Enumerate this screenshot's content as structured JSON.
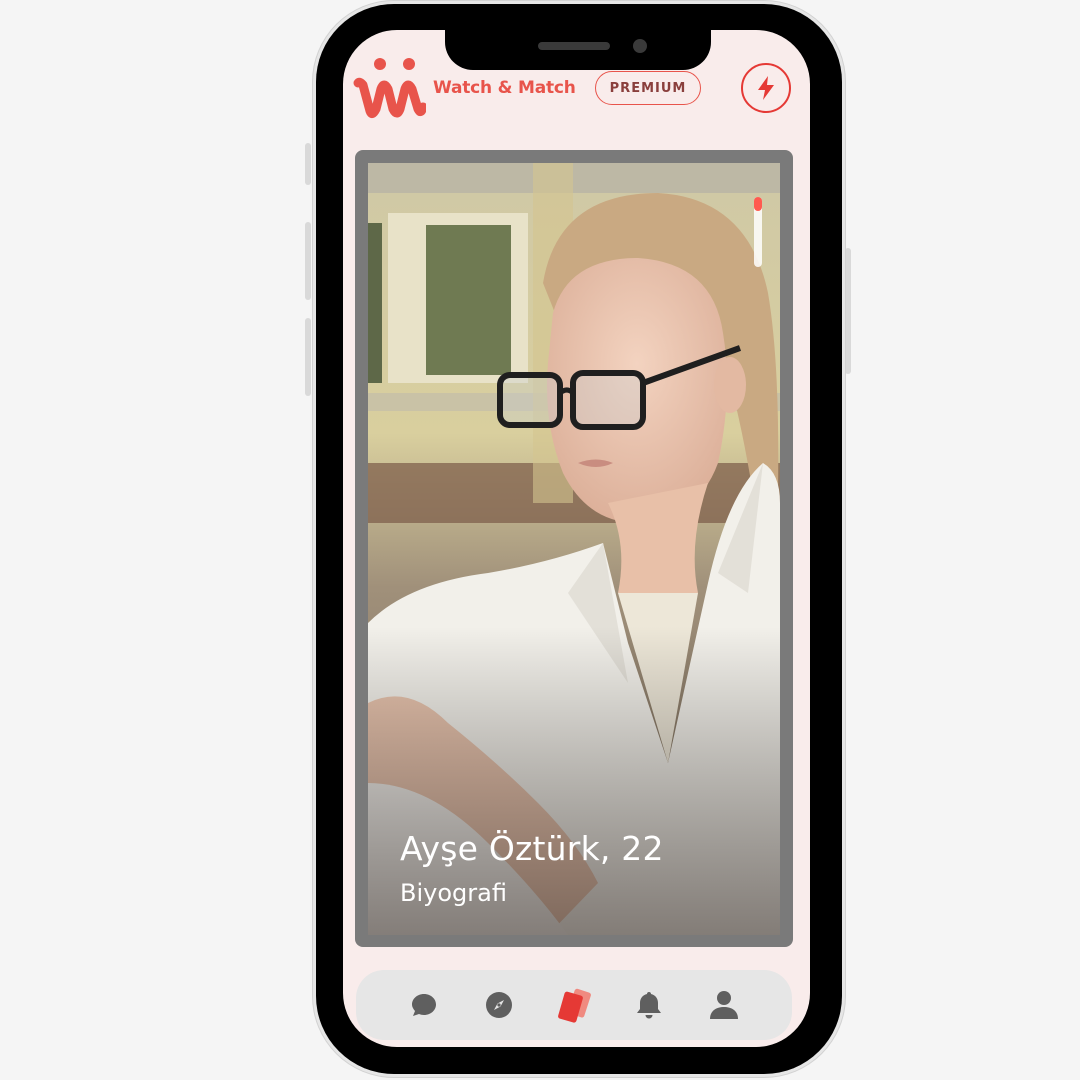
{
  "header": {
    "brand_name": "Watch & Match",
    "premium_label": "PREMIUM",
    "logo_icon": "watch-and-match-logo-icon",
    "boost_icon": "lightning-bolt-icon"
  },
  "profile_card": {
    "name_age": "Ayşe Öztürk, 22",
    "bio": "Biyografi",
    "photo_progress_fraction": 0.2
  },
  "bottom_nav": {
    "items": [
      {
        "icon": "chat-bubble-icon",
        "active": false
      },
      {
        "icon": "compass-icon",
        "active": false
      },
      {
        "icon": "cards-icon",
        "active": true
      },
      {
        "icon": "bell-icon",
        "active": false
      },
      {
        "icon": "profile-icon",
        "active": false
      }
    ]
  },
  "colors": {
    "brand": "#e8544b",
    "accent": "#e53935",
    "screen_background": "#f9eceb",
    "nav_background": "#e6e6e6",
    "nav_inactive_icon": "#5f5f5f",
    "progress": "#ff5a4f"
  }
}
